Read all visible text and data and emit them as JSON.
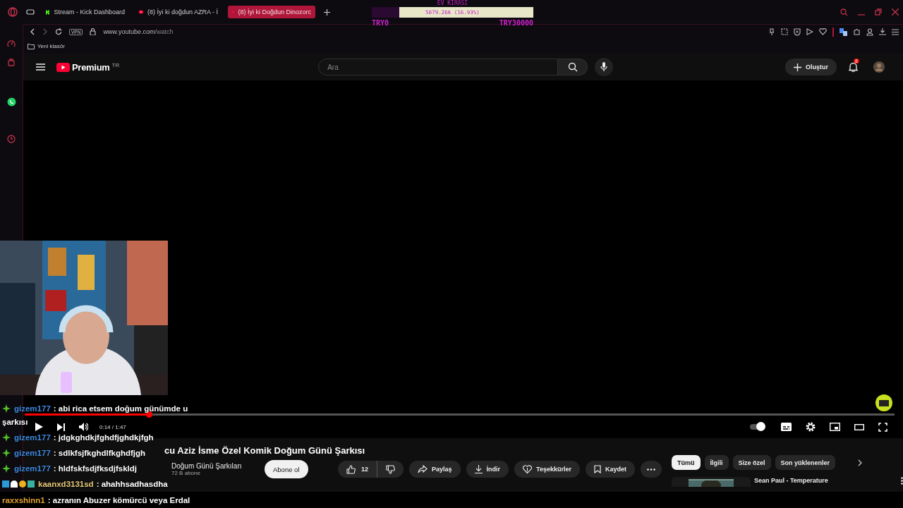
{
  "browser": {
    "tabs": [
      {
        "title": "Stream - Kick Dashboard",
        "kind": "kick",
        "selected": false
      },
      {
        "title": "(8) İyi ki doğdun AZRA - İ",
        "kind": "youtube",
        "selected": false
      },
      {
        "title": "(8) İyi ki Doğdun Dinozorc",
        "kind": "youtube",
        "selected": true
      }
    ],
    "vpn": "VPN",
    "url_host": "www.youtube.com",
    "url_path": "/watch",
    "bookmarks": [
      "Yeni klasör"
    ]
  },
  "goal": {
    "title": "EV KİRASI",
    "reading": "5079.26₺ (16.93%)",
    "level": 0.1693,
    "min": "TRY0",
    "max": "TRY30000"
  },
  "youtube": {
    "logo": "Premium",
    "region": "TR",
    "search_placeholder": "Ara",
    "create": "Oluştur",
    "notifications": "8",
    "player": {
      "time": "0:14 / 1:47",
      "level": 0.143,
      "autoplay": true
    },
    "title": "cu Aziz İsme Özel Komik Doğum Günü Şarkısı",
    "channel": "Doğum Günü Şarkıları",
    "subscribers": "72 B abone",
    "subscribe": "Abone ol",
    "likes": "12",
    "actions": [
      {
        "kind": "share",
        "label": "Paylaş"
      },
      {
        "kind": "download",
        "label": "İndir"
      },
      {
        "kind": "thanks",
        "label": "Teşekkürler"
      },
      {
        "kind": "save",
        "label": "Kaydet"
      }
    ],
    "chips": [
      {
        "label": "Tümü",
        "selected": true
      },
      {
        "label": "İlgili",
        "selected": false
      },
      {
        "label": "Size özel",
        "selected": false
      },
      {
        "label": "Son yüklenenler",
        "selected": false
      }
    ],
    "recommendation": {
      "title": "Sean Paul - Temperature"
    }
  },
  "chat": [
    {
      "user": "gizem177",
      "color": "#3f8ae0",
      "text": ": abi rica etsem doğum günümde u",
      "continuation": "şarkısı"
    },
    {
      "user": "gizem177",
      "color": "#3f8ae0",
      "text": ": jdgkghdkjfghdfjghdkjfgh"
    },
    {
      "user": "gizem177",
      "color": "#3f8ae0",
      "text": ": sdlkfsjfkghdlfkghdfjgh"
    },
    {
      "user": "gizem177",
      "color": "#3f8ae0",
      "text": ": hldfskfsdjfksdjfskldj"
    },
    {
      "user": "kaanxd3131sd",
      "color": "#e8c77a",
      "text": ": ahahhsadhasdha",
      "badges": true
    }
  ],
  "bottom_chat": {
    "user": "raxxshinn1",
    "color": "#e0a030",
    "text": ": azranın Abuzer kömürcü veya Erdal"
  }
}
